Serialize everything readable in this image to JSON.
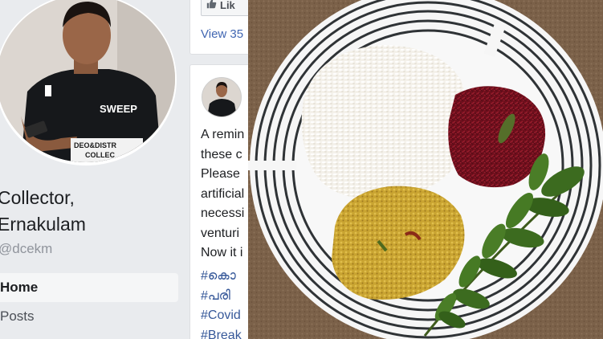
{
  "profile": {
    "name_line1": "Collector,",
    "name_line2": "Ernakulam",
    "handle": "@dcekm",
    "avatar_shirt_text": "SWEEP",
    "avatar_nameplate_line1": "DEO&DISTR",
    "avatar_nameplate_line2": "COLLEC"
  },
  "nav": {
    "home": "Home",
    "posts": "Posts"
  },
  "post": {
    "like_label": "Lik",
    "view_comments": "View 35",
    "lines": [
      "A remin",
      "these c",
      "Please",
      "artificial",
      "necessi",
      "venturi",
      "Now it i"
    ],
    "hashtags": [
      "#കൊ",
      "#പരി",
      "#Covid",
      "#Break"
    ]
  },
  "colors": {
    "link": "#4267b2",
    "hashtag": "#365899",
    "nav_active_bg": "#f5f6f7"
  }
}
